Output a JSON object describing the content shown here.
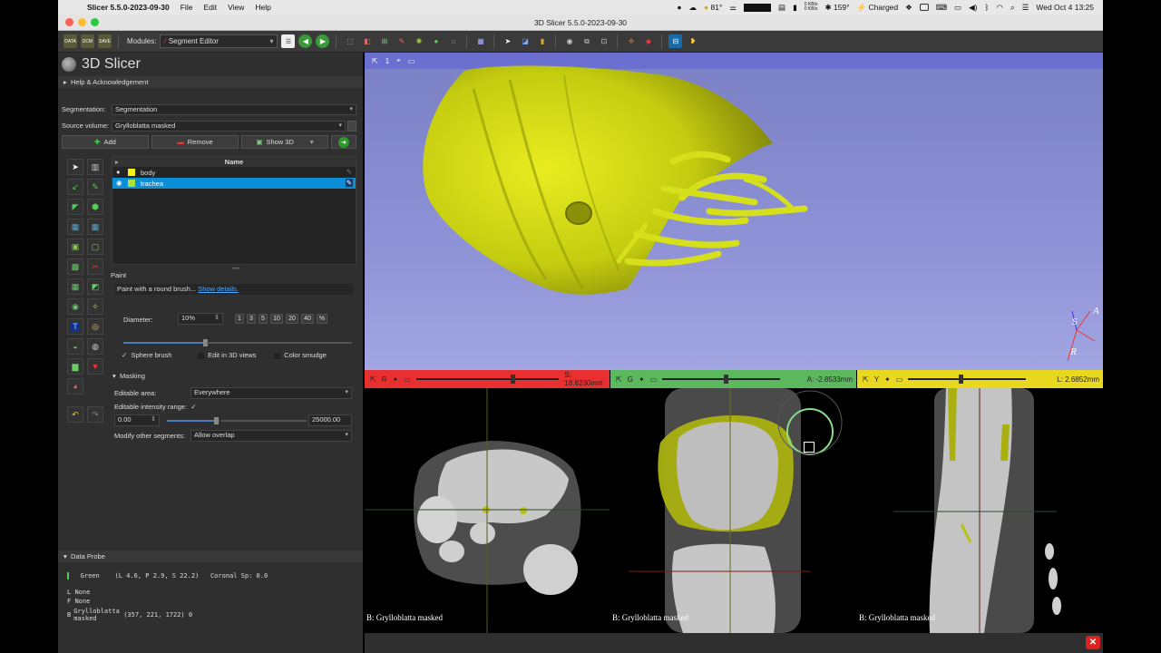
{
  "menubar": {
    "app_name": "Slicer 5.5.0-2023-09-30",
    "items": [
      "File",
      "Edit",
      "View",
      "Help"
    ],
    "status": {
      "temperature": "81°",
      "rate_up": "0 KB/s",
      "rate_down": "0 KB/s",
      "cpu_temp": "159°",
      "battery": "Charged",
      "datetime": "Wed Oct 4  13:25"
    }
  },
  "window": {
    "title": "3D Slicer 5.5.0-2023-09-30"
  },
  "toolbar": {
    "data_label": "DATA",
    "dcm_label": "DCM",
    "save_label": "SAVE",
    "modules_label": "Modules:",
    "module_selected": "Segment Editor"
  },
  "app_logo": {
    "text": "3D Slicer"
  },
  "help_section": {
    "label": "Help & Acknowledgement"
  },
  "segment_editor": {
    "segmentation_label": "Segmentation:",
    "segmentation_value": "Segmentation",
    "source_volume_label": "Source volume:",
    "source_volume_value": "Grylloblatta masked",
    "add_label": "Add",
    "remove_label": "Remove",
    "show3d_label": "Show 3D",
    "table_header": "Name",
    "segments": [
      {
        "name": "body",
        "color": "#f4f40a"
      },
      {
        "name": "trachea",
        "color": "#a6e63c"
      }
    ],
    "effect_name": "Paint",
    "effect_help": "Paint with a round brush...",
    "effect_help_link": "Show details.",
    "diameter_label": "Diameter:",
    "diameter_value": "10%",
    "diameter_presets": [
      "1",
      "3",
      "5",
      "10",
      "20",
      "40",
      "%"
    ],
    "sphere_brush_label": "Sphere brush",
    "edit_3d_label": "Edit in 3D views",
    "color_smudge_label": "Color smudge",
    "masking_label": "Masking",
    "editable_area_label": "Editable area:",
    "editable_area_value": "Everywhere",
    "intensity_range_label": "Editable intensity range:",
    "intensity_min": "0.00",
    "intensity_max": "25000.00",
    "modify_other_label": "Modify other segments:",
    "modify_other_value": "Allow overlap"
  },
  "data_probe": {
    "label": "Data Probe",
    "view_name": "Green",
    "coords": "(L 4.6, P 2.9, S 22.2)",
    "orientation": "Coronal Sp: 0.0",
    "rows": [
      {
        "key": "L",
        "value": "None",
        "extra": ""
      },
      {
        "key": "F",
        "value": "None",
        "extra": ""
      },
      {
        "key": "B",
        "value": "Grylloblatta masked",
        "extra": "(357, 221, 1722) 0"
      }
    ]
  },
  "view3d": {
    "index": "1"
  },
  "slice_views": [
    {
      "id": "red",
      "letter": "R",
      "offset": "S: 18.8230mm",
      "volume": "B: Grylloblatta masked",
      "color": "#e83030"
    },
    {
      "id": "green",
      "letter": "G",
      "offset": "A: -2.8533mm",
      "volume": "B: Grylloblatta masked",
      "color": "#5cb85c"
    },
    {
      "id": "yellow",
      "letter": "Y",
      "offset": "L: 2.6852mm",
      "volume": "B: Grylloblatta masked",
      "color": "#e8d820"
    }
  ],
  "axes": {
    "s": "S",
    "a": "A",
    "r": "R"
  }
}
